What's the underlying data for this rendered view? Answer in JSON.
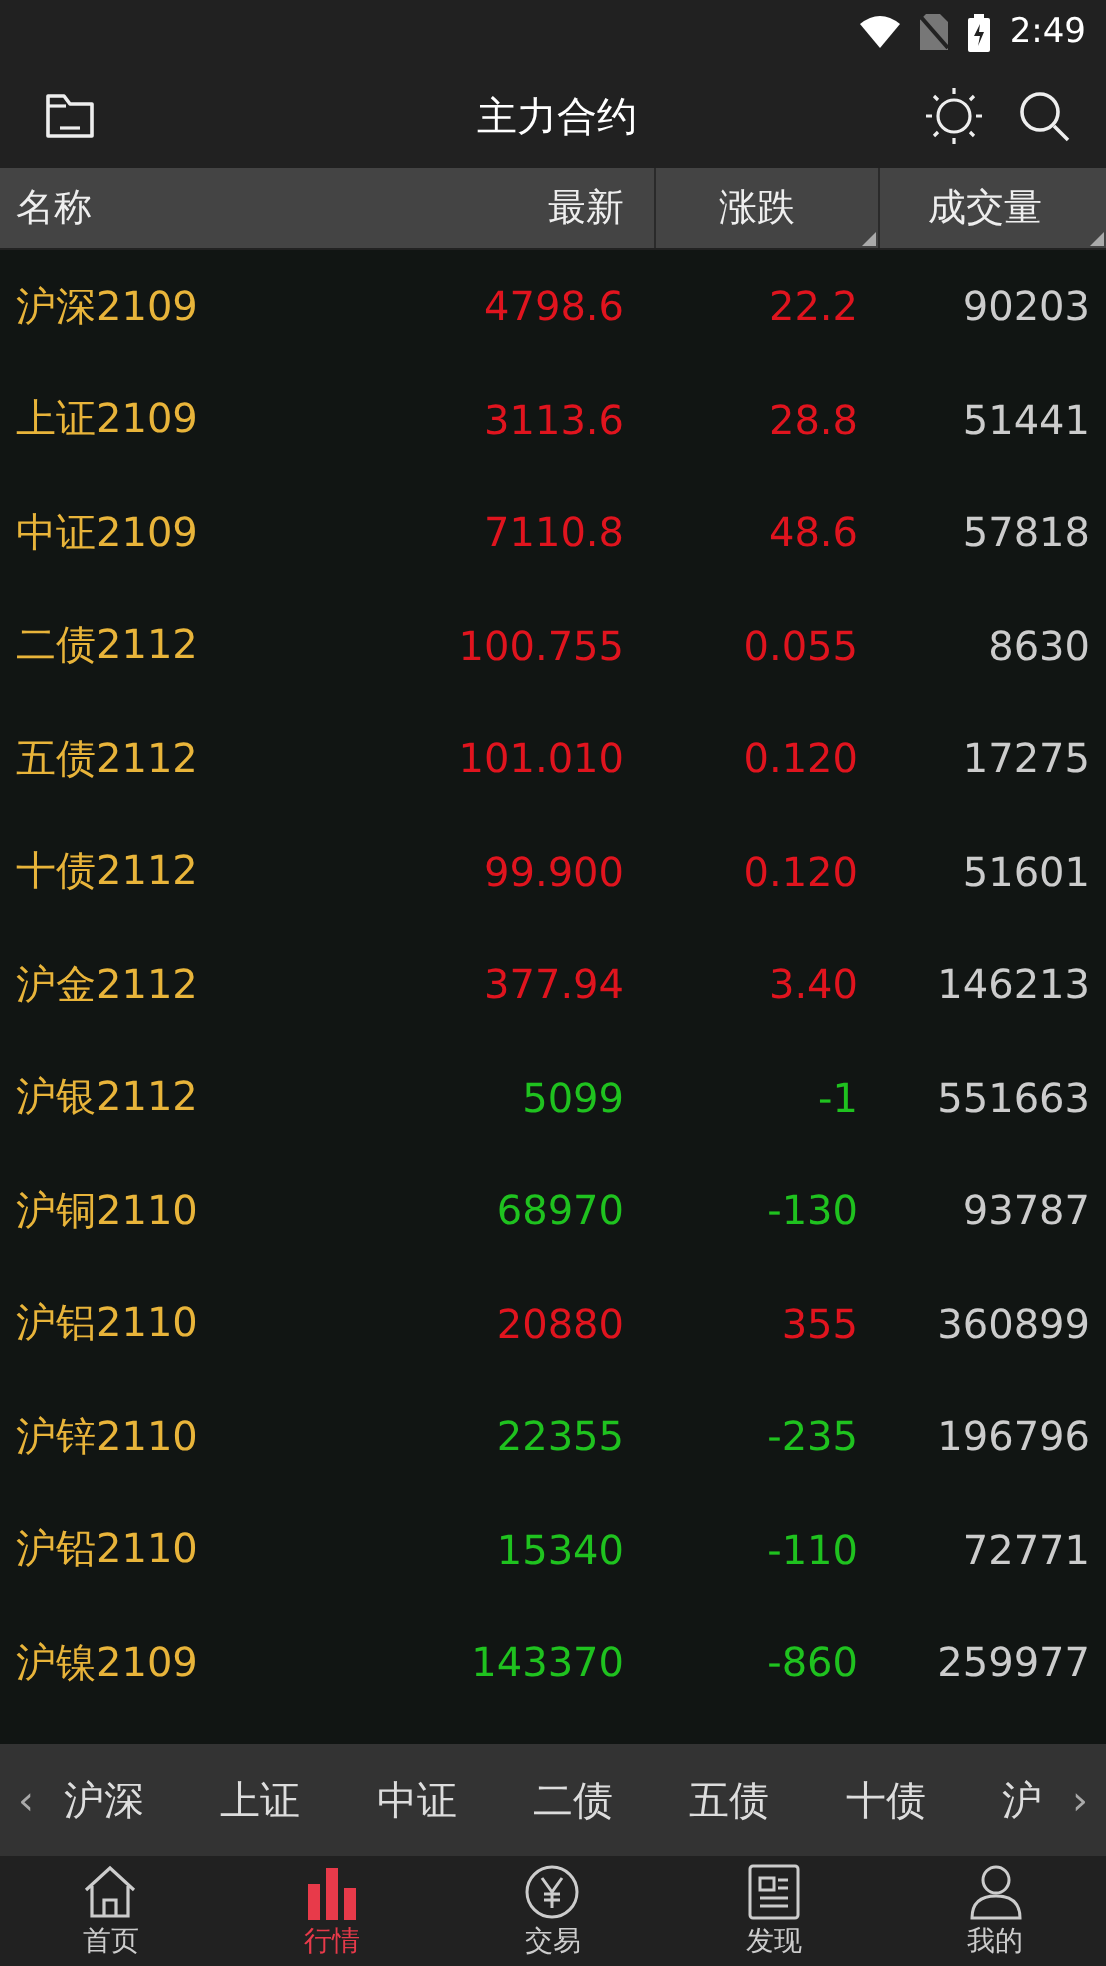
{
  "status_bar": {
    "time": "2:49"
  },
  "header": {
    "title": "主力合约"
  },
  "table": {
    "columns": [
      {
        "label": "名称",
        "sortable": false
      },
      {
        "label": "最新",
        "sortable": false
      },
      {
        "label": "涨跌",
        "sortable": true
      },
      {
        "label": "成交量",
        "sortable": true
      }
    ],
    "rows": [
      {
        "name": "沪深2109",
        "last": "4798.6",
        "change": "22.2",
        "volume": "90203",
        "rising": true
      },
      {
        "name": "上证2109",
        "last": "3113.6",
        "change": "28.8",
        "volume": "51441",
        "rising": true
      },
      {
        "name": "中证2109",
        "last": "7110.8",
        "change": "48.6",
        "volume": "57818",
        "rising": true
      },
      {
        "name": "二债2112",
        "last": "100.755",
        "change": "0.055",
        "volume": "8630",
        "rising": true
      },
      {
        "name": "五债2112",
        "last": "101.010",
        "change": "0.120",
        "volume": "17275",
        "rising": true
      },
      {
        "name": "十债2112",
        "last": "99.900",
        "change": "0.120",
        "volume": "51601",
        "rising": true
      },
      {
        "name": "沪金2112",
        "last": "377.94",
        "change": "3.40",
        "volume": "146213",
        "rising": true
      },
      {
        "name": "沪银2112",
        "last": "5099",
        "change": "-1",
        "volume": "551663",
        "rising": false
      },
      {
        "name": "沪铜2110",
        "last": "68970",
        "change": "-130",
        "volume": "93787",
        "rising": false
      },
      {
        "name": "沪铝2110",
        "last": "20880",
        "change": "355",
        "volume": "360899",
        "rising": true
      },
      {
        "name": "沪锌2110",
        "last": "22355",
        "change": "-235",
        "volume": "196796",
        "rising": false
      },
      {
        "name": "沪铅2110",
        "last": "15340",
        "change": "-110",
        "volume": "72771",
        "rising": false
      },
      {
        "name": "沪镍2109",
        "last": "143370",
        "change": "-860",
        "volume": "259977",
        "rising": false
      }
    ]
  },
  "category_bar": {
    "scroll_left": "‹",
    "items": [
      "沪深",
      "上证",
      "中证",
      "二债",
      "五债",
      "十债",
      "沪"
    ],
    "scroll_right": "›"
  },
  "bottom_nav": [
    {
      "label": "首页",
      "kind": "home",
      "selected": false
    },
    {
      "label": "行情",
      "kind": "chart",
      "selected": true
    },
    {
      "label": "交易",
      "kind": "yen",
      "selected": false
    },
    {
      "label": "发现",
      "kind": "news",
      "selected": false
    },
    {
      "label": "我的",
      "kind": "user",
      "selected": false
    }
  ]
}
